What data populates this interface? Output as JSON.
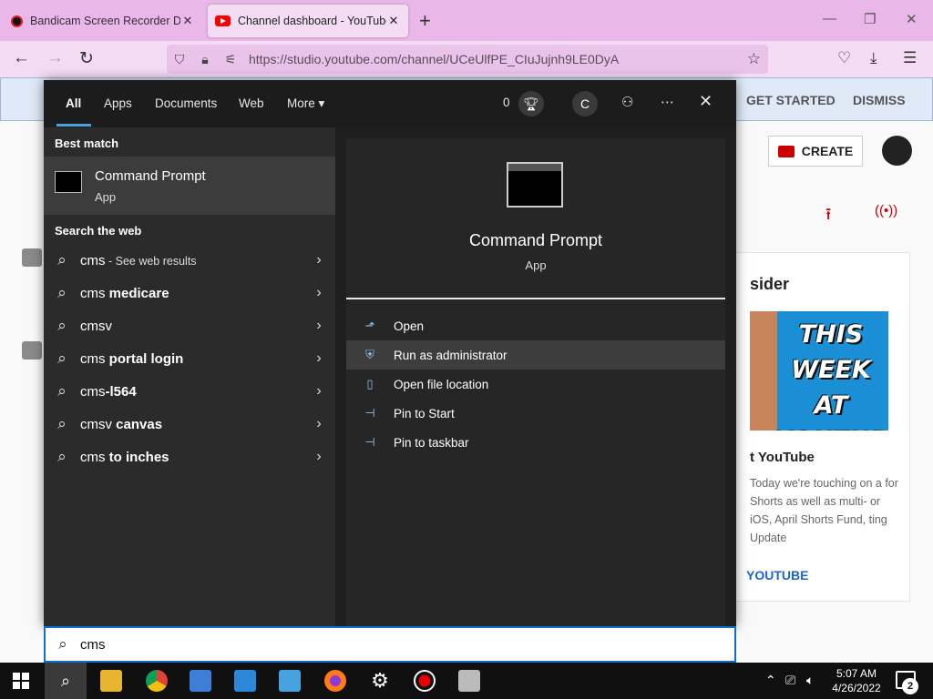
{
  "browser": {
    "tabs": [
      {
        "title": "Bandicam Screen Recorder Dow",
        "icon": "record-dot-icon"
      },
      {
        "title": "Channel dashboard - YouTube",
        "icon": "youtube-icon"
      }
    ],
    "tab_close": "✕",
    "new_tab": "+",
    "window_controls": {
      "minimize": "—",
      "restore": "❐",
      "close": "✕"
    },
    "url": "https://studio.youtube.com/channel/UCeUlfPE_CIuJujnh9LE0DyA",
    "nav": {
      "back": "←",
      "forward": "→",
      "reload": "↻"
    },
    "accent": "#e9b8e9"
  },
  "youtube": {
    "banner": {
      "get_started": "GET STARTED",
      "dismiss": "DISMISS"
    },
    "create_label": "CREATE",
    "card": {
      "title": "sider",
      "thumb_text": "THIS WEEK AT YOUTUBE",
      "subtitle": "t YouTube",
      "body": "Today we're touching on a for Shorts as well as multi- or iOS, April Shorts Fund, ting Update",
      "link": "YOUTUBE"
    }
  },
  "search": {
    "tabs": [
      "All",
      "Apps",
      "Documents",
      "Web",
      "More"
    ],
    "more_caret": "▾",
    "points": "0",
    "user_initial": "C",
    "best_match_heading": "Best match",
    "best_match": {
      "title": "Command Prompt",
      "subtitle": "App"
    },
    "web_heading": "Search the web",
    "web_results": [
      {
        "prefix": "cms",
        "bold": "",
        "suffix": " - See web results"
      },
      {
        "prefix": "cms ",
        "bold": "medicare",
        "suffix": ""
      },
      {
        "prefix": "cmsv",
        "bold": "",
        "suffix": ""
      },
      {
        "prefix": "cms ",
        "bold": "portal login",
        "suffix": ""
      },
      {
        "prefix": "cms",
        "bold": "-l564",
        "suffix": ""
      },
      {
        "prefix": "cmsv ",
        "bold": "canvas",
        "suffix": ""
      },
      {
        "prefix": "cms ",
        "bold": "to inches",
        "suffix": ""
      }
    ],
    "detail": {
      "title": "Command Prompt",
      "subtitle": "App"
    },
    "actions": [
      "Open",
      "Run as administrator",
      "Open file location",
      "Pin to Start",
      "Pin to taskbar"
    ],
    "query": "cms"
  },
  "taskbar": {
    "time": "5:07 AM",
    "date": "4/26/2022",
    "notifications": "2"
  }
}
